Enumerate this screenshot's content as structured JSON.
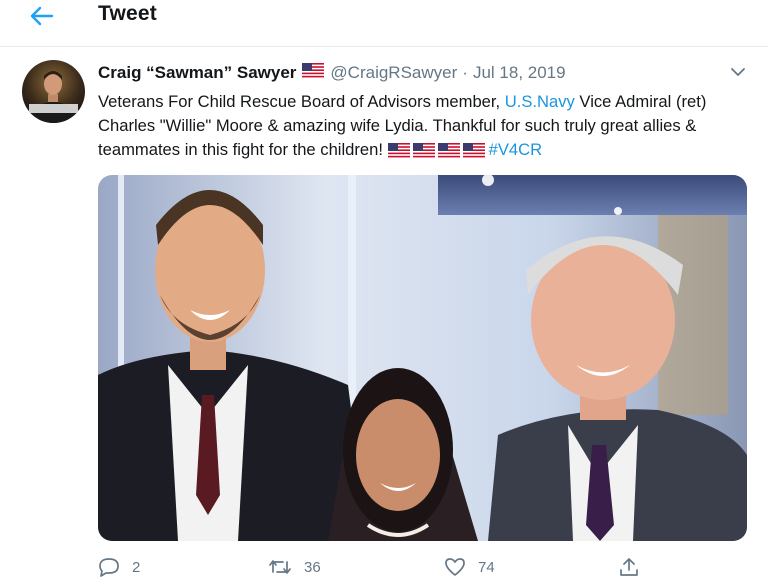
{
  "header": {
    "title": "Tweet",
    "back_icon": "arrow-left-icon",
    "accent_color": "#1da1f2"
  },
  "tweet": {
    "author": {
      "display_name": "Craig “Sawman” Sawyer",
      "handle": "@CraigRSawyer",
      "flag_icon": "us-flag-icon",
      "avatar_caption": "SAWYER NAVY SEAL"
    },
    "separator": "·",
    "date": "Jul 18, 2019",
    "text": {
      "part1": "Veterans For Child Rescue Board of Advisors member, ",
      "link": "U.S.Navy",
      "part2": " Vice Admiral (ret) Charles \"Willie\" Moore & amazing wife Lydia. Thankful for such truly great allies & teammates in this fight for the children! ",
      "hashtag": "#V4CR"
    },
    "media_icon": "photo",
    "link_color": "#1b95e0"
  },
  "actions": {
    "reply_count": "2",
    "retweet_count": "36",
    "like_count": "74"
  }
}
